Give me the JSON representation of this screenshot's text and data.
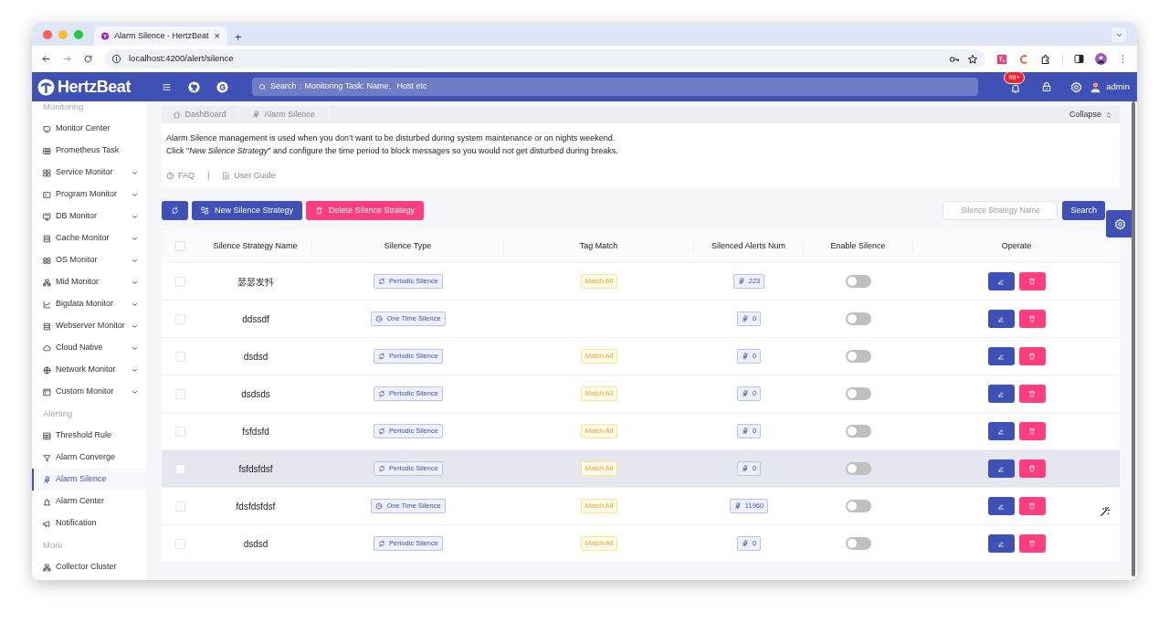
{
  "browser": {
    "tab_title": "Alarm Silence - HertzBeat",
    "tab_close": "×",
    "new_tab": "+",
    "url": "localhost:4200/alert/silence"
  },
  "header": {
    "logo": "HertzBeat",
    "search_placeholder": "Search：Monitoring Task: Name、Host etc",
    "notification_badge": "99+",
    "user": "admin"
  },
  "sidebar": {
    "sections": [
      {
        "title": "Monitoring",
        "items": [
          {
            "label": "Monitor Center",
            "kind": "link",
            "selected": false
          },
          {
            "label": "Prometheus Task",
            "kind": "link",
            "selected": false
          },
          {
            "label": "Service Monitor",
            "kind": "submenu",
            "selected": false
          },
          {
            "label": "Program Monitor",
            "kind": "submenu",
            "selected": false
          },
          {
            "label": "DB Monitor",
            "kind": "submenu",
            "selected": false
          },
          {
            "label": "Cache Monitor",
            "kind": "submenu",
            "selected": false
          },
          {
            "label": "OS Monitor",
            "kind": "submenu",
            "selected": false
          },
          {
            "label": "Mid Monitor",
            "kind": "submenu",
            "selected": false
          },
          {
            "label": "Bigdata Monitor",
            "kind": "submenu",
            "selected": false
          },
          {
            "label": "Webserver Monitor",
            "kind": "submenu",
            "selected": false
          },
          {
            "label": "Cloud Native",
            "kind": "submenu",
            "selected": false
          },
          {
            "label": "Network Monitor",
            "kind": "submenu",
            "selected": false
          },
          {
            "label": "Custom Monitor",
            "kind": "submenu",
            "selected": false
          }
        ]
      },
      {
        "title": "Alerting",
        "items": [
          {
            "label": "Threshold Rule",
            "kind": "link",
            "selected": false
          },
          {
            "label": "Alarm Converge",
            "kind": "link",
            "selected": false
          },
          {
            "label": "Alarm Silence",
            "kind": "link",
            "selected": true
          },
          {
            "label": "Alarm Center",
            "kind": "link",
            "selected": false
          },
          {
            "label": "Notification",
            "kind": "link",
            "selected": false
          }
        ]
      },
      {
        "title": "More",
        "items": [
          {
            "label": "Collector Cluster",
            "kind": "link",
            "selected": false
          }
        ]
      }
    ]
  },
  "breadcrumb": {
    "tabs": [
      "DashBoard",
      "Alarm Silence"
    ],
    "collapse": "Collapse"
  },
  "intro": {
    "lines": [
      "Alarm Silence management is used when you don’t want to be disturbed during system maintenance or on nights weekend.",
      "Click \"*New Silence Strategy*\" and configure the time period to block messages so you would not get disturbed during breaks."
    ],
    "links": [
      "FAQ",
      "User Guide"
    ],
    "separator": "|"
  },
  "toolbar": {
    "new_button": "New Silence Strategy",
    "delete_button": "Delete Silence Strategy",
    "search_placeholder": "Silence Strategy Name",
    "search_button": "Search"
  },
  "table": {
    "select_all": {
      "checked": false
    },
    "columns": [
      "Silence Strategy Name",
      "Silence Type",
      "Tag Match",
      "Silenced Alerts Num",
      "Enable Silence",
      "Operate"
    ],
    "rows": [
      {
        "checked": false,
        "hovered": false,
        "name": "瑟瑟发抖",
        "type": {
          "kind": "periodic",
          "label": "Periodic Silence"
        },
        "tag_match": "Match All",
        "alerts_num": "223",
        "enabled": false
      },
      {
        "checked": false,
        "hovered": false,
        "name": "ddssdf",
        "type": {
          "kind": "once",
          "label": "One Time Silence"
        },
        "alerts_num": "0",
        "enabled": false
      },
      {
        "checked": false,
        "hovered": false,
        "name": "dsdsd",
        "type": {
          "kind": "periodic",
          "label": "Periodic Silence"
        },
        "tag_match": "Match All",
        "alerts_num": "0",
        "enabled": false
      },
      {
        "checked": false,
        "hovered": false,
        "name": "dsdsds",
        "type": {
          "kind": "periodic",
          "label": "Periodic Silence"
        },
        "tag_match": "Match All",
        "alerts_num": "0",
        "enabled": false
      },
      {
        "checked": false,
        "hovered": false,
        "name": "fsfdsfd",
        "type": {
          "kind": "periodic",
          "label": "Periodic Silence"
        },
        "tag_match": "Match All",
        "alerts_num": "0",
        "enabled": false
      },
      {
        "checked": false,
        "hovered": true,
        "name": "fsfdsfdsf",
        "type": {
          "kind": "periodic",
          "label": "Periodic Silence"
        },
        "tag_match": "Match All",
        "alerts_num": "0",
        "enabled": false
      },
      {
        "checked": false,
        "hovered": false,
        "name": "fdsfdsfdsf",
        "type": {
          "kind": "once",
          "label": "One Time Silence"
        },
        "tag_match": "Match All",
        "alerts_num": "11960",
        "enabled": false
      },
      {
        "checked": false,
        "hovered": false,
        "name": "dsdsd",
        "type": {
          "kind": "periodic",
          "label": "Periodic Silence"
        },
        "tag_match": "Match All",
        "alerts_num": "0",
        "enabled": false
      }
    ]
  }
}
